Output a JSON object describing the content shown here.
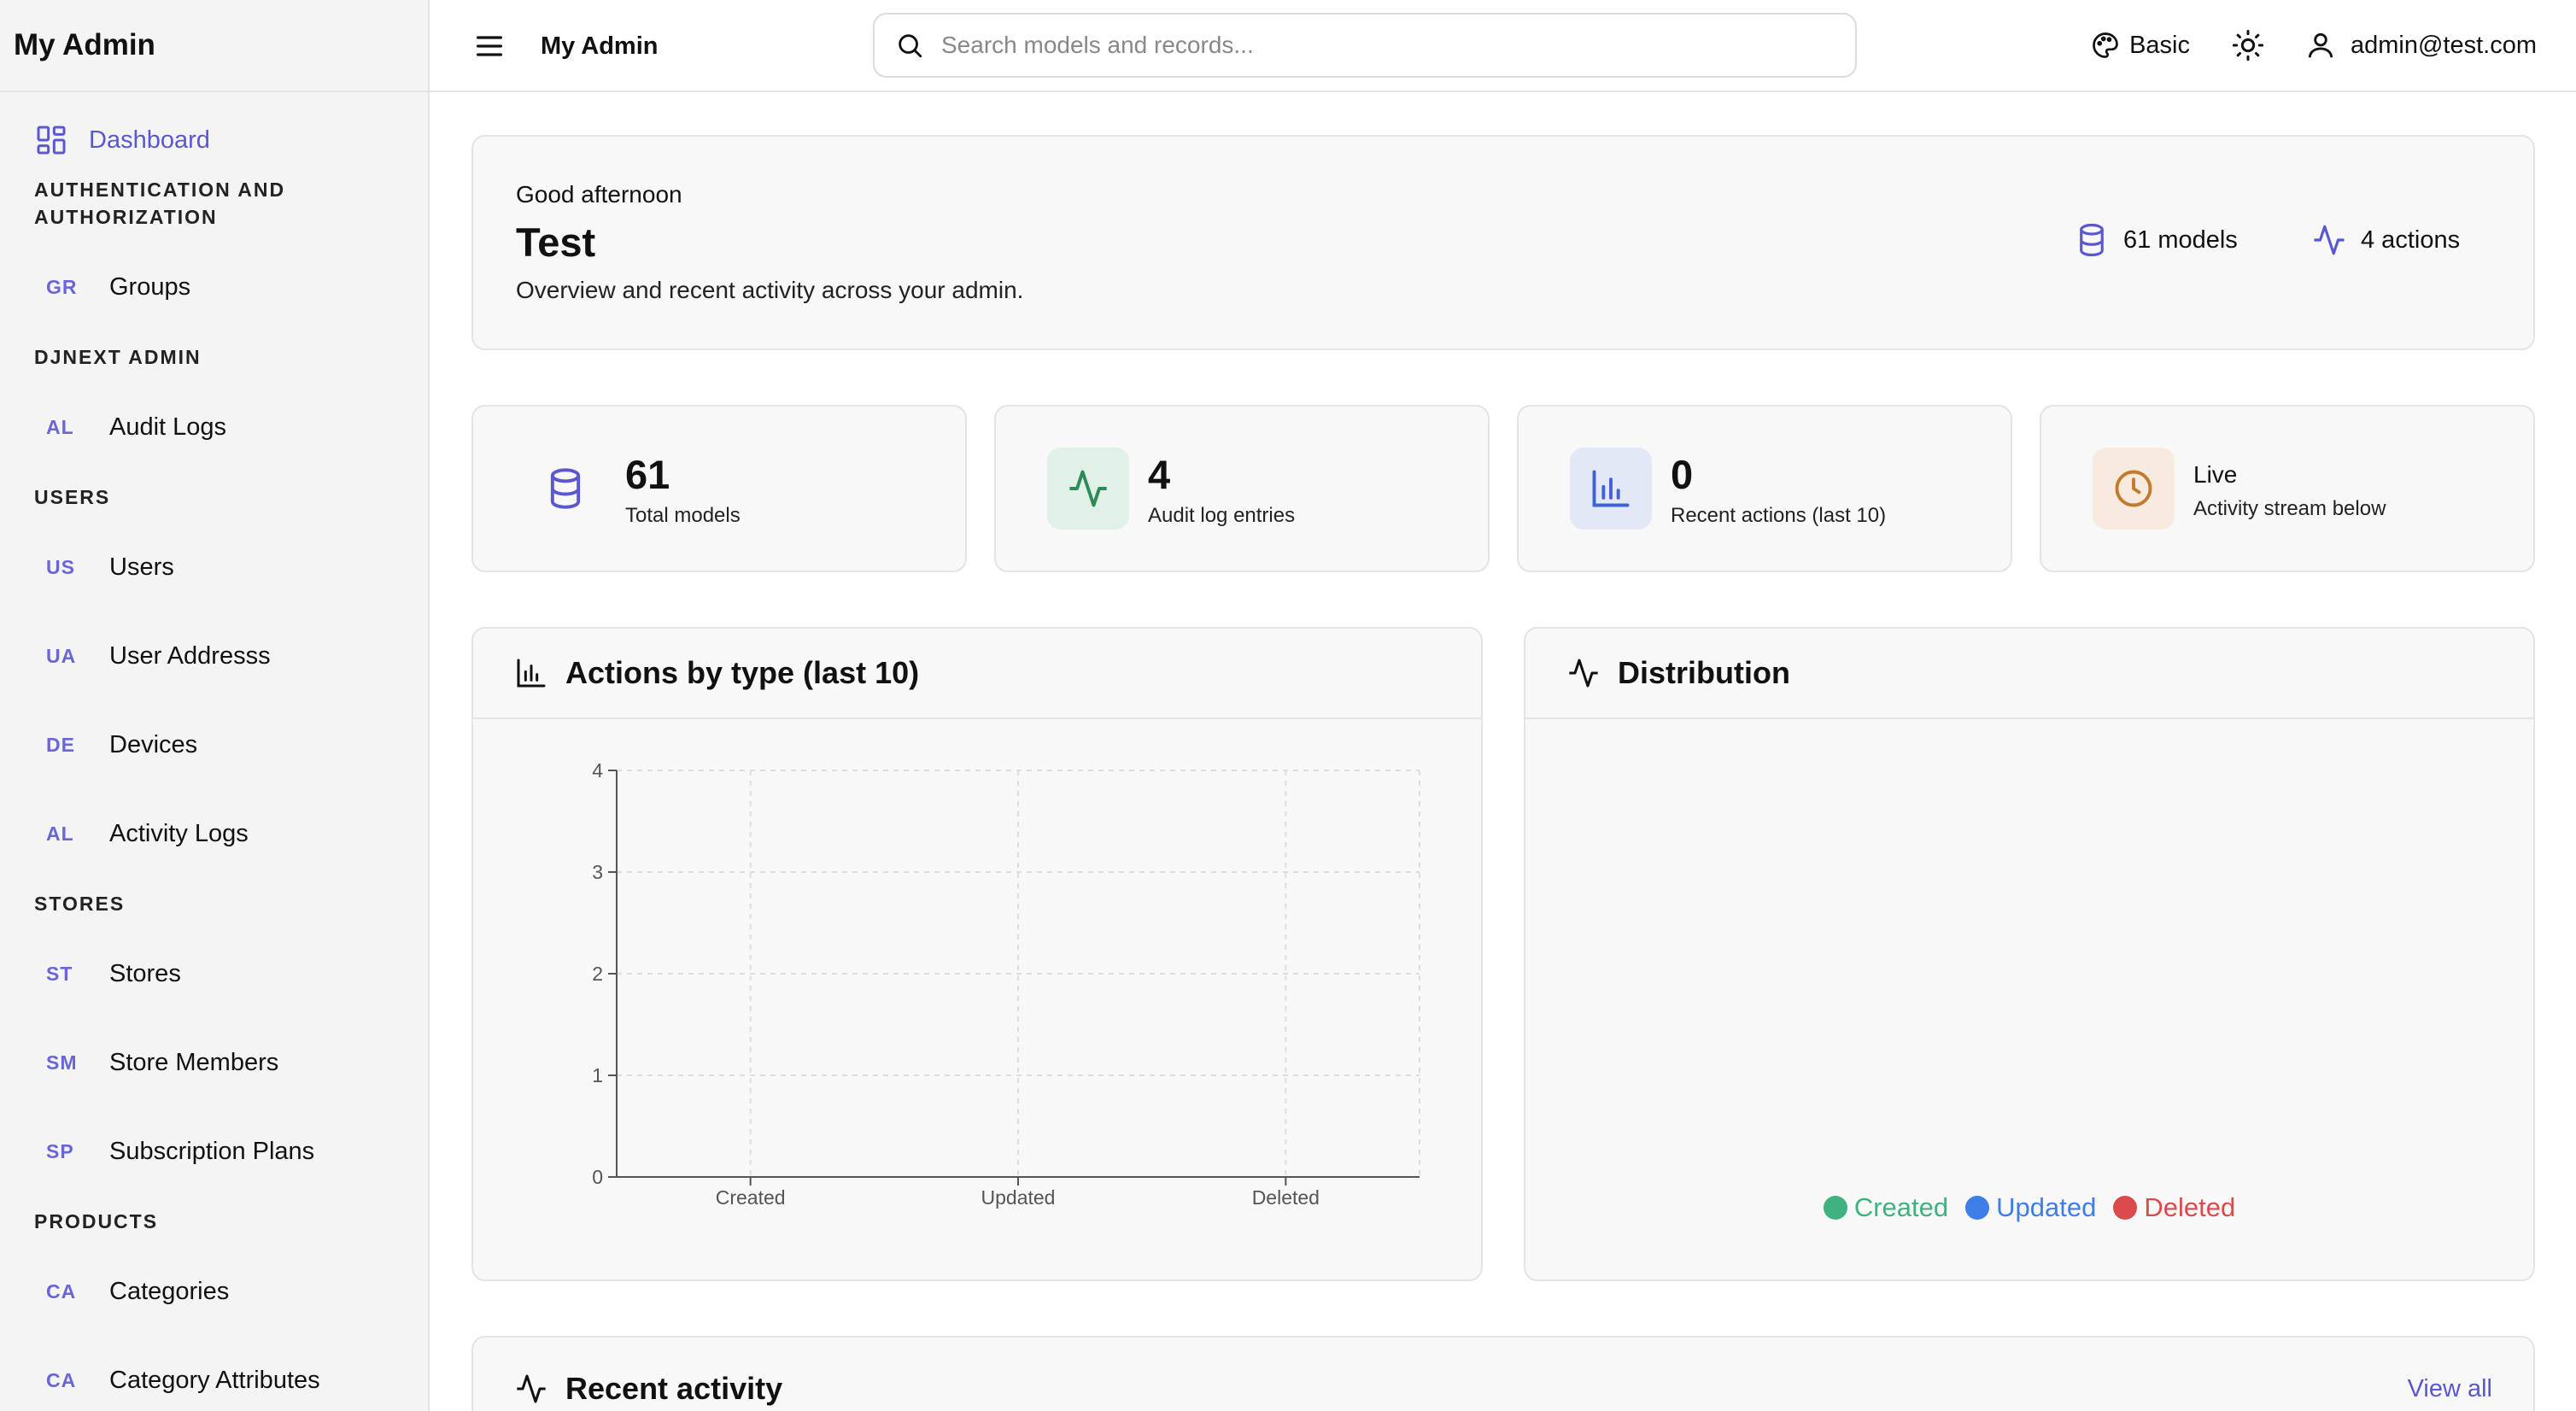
{
  "sidebar": {
    "brand": "My Admin",
    "dashboard_label": "Dashboard",
    "sections": [
      {
        "title": "AUTHENTICATION AND AUTHORIZATION",
        "items": [
          {
            "abbr": "GR",
            "label": "Groups"
          }
        ]
      },
      {
        "title": "DJNEXT ADMIN",
        "items": [
          {
            "abbr": "AL",
            "label": "Audit Logs"
          }
        ]
      },
      {
        "title": "USERS",
        "items": [
          {
            "abbr": "US",
            "label": "Users"
          },
          {
            "abbr": "UA",
            "label": "User Addresss"
          },
          {
            "abbr": "DE",
            "label": "Devices"
          },
          {
            "abbr": "AL",
            "label": "Activity Logs"
          }
        ]
      },
      {
        "title": "STORES",
        "items": [
          {
            "abbr": "ST",
            "label": "Stores"
          },
          {
            "abbr": "SM",
            "label": "Store Members"
          },
          {
            "abbr": "SP",
            "label": "Subscription Plans"
          }
        ]
      },
      {
        "title": "PRODUCTS",
        "items": [
          {
            "abbr": "CA",
            "label": "Categories"
          },
          {
            "abbr": "CA",
            "label": "Category Attributes"
          }
        ]
      }
    ]
  },
  "topbar": {
    "title": "My Admin",
    "search_placeholder": "Search models and records...",
    "theme_label": "Basic",
    "user_email": "admin@test.com"
  },
  "hero": {
    "greeting": "Good afternoon",
    "name": "Test",
    "subtitle": "Overview and recent activity across your admin.",
    "models_stat": "61 models",
    "actions_stat": "4 actions"
  },
  "stats": [
    {
      "value": "61",
      "label": "Total models"
    },
    {
      "value": "4",
      "label": "Audit log entries"
    },
    {
      "value": "0",
      "label": "Recent actions (last 10)"
    },
    {
      "value": "Live",
      "label": "Activity stream below"
    }
  ],
  "colors": {
    "accent": "#5b57d1",
    "created": "#3fb27f",
    "updated": "#3f7ee8",
    "deleted": "#dc4b4b",
    "live": "#c47a2c"
  },
  "chart_panel": {
    "title": "Actions by type (last 10)"
  },
  "chart_data": {
    "type": "bar",
    "categories": [
      "Created",
      "Updated",
      "Deleted"
    ],
    "values": [
      0,
      0,
      0
    ],
    "yticks": [
      0,
      1,
      2,
      3,
      4
    ],
    "ylim": [
      0,
      4
    ],
    "grid": true
  },
  "distribution": {
    "title": "Distribution",
    "legend": [
      {
        "label": "Created",
        "color": "#3fb27f"
      },
      {
        "label": "Updated",
        "color": "#3f7ee8"
      },
      {
        "label": "Deleted",
        "color": "#dc4b4b"
      }
    ]
  },
  "recent": {
    "title": "Recent activity",
    "view_all": "View all"
  }
}
